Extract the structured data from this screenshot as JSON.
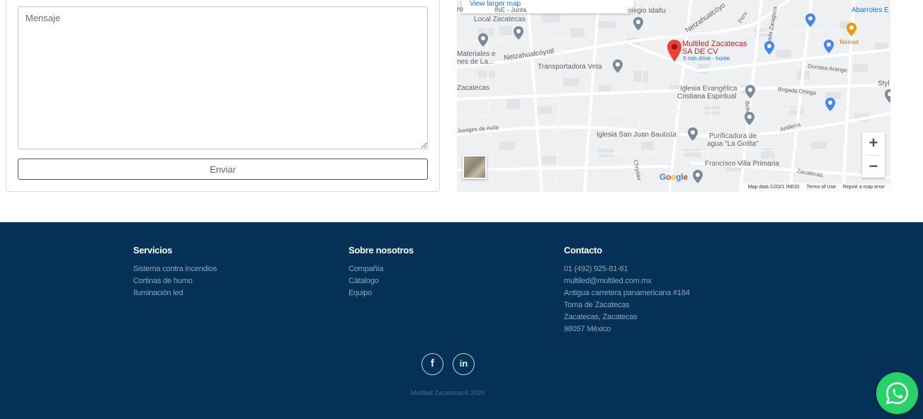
{
  "form": {
    "message_placeholder": "Mensaje",
    "send_label": "Enviar"
  },
  "map": {
    "view_larger": "View larger map",
    "place_name_line1": "Multiled Zacatecas",
    "place_name_line2": "SA DE CV",
    "place_drive": "9 min drive - home",
    "labels": {
      "colegio": "olegio Idaltu",
      "local": "Local Zacatecas",
      "ine": "INE - Junta",
      "materiales1": "Materiales e",
      "materiales2": "nes de La...",
      "netza1": "Netzahualcóyotl",
      "netza2": "Netzahualcóyo",
      "transportadora": "Transportadora Veta",
      "zacatecas": "Zacatecas",
      "iglesia_ev1": "Iglesia Evangélica",
      "iglesia_ev2": "Cristiana Espiritual",
      "brigada": "Brigada Ortega",
      "artiller": "Artillería",
      "iglesia_sj": "Iglesia San Juan Bautista",
      "purificadora1": "Purificadora de",
      "purificadora2": "agua \"La Gotita\"",
      "francisco": "Francisco Villa Primaria",
      "abarrotes": "Abarrotes E",
      "takeout": "Takeout",
      "dorotea": "Dorotea Arango",
      "peru": "Peru",
      "brigada_z": "Brigada Zaragoza",
      "chrysler": "Chrysler",
      "bolivia": "Bolivia",
      "zac_road": "Zacatecas",
      "juwiges": "Juwiges de Avila",
      "styl": "Styl",
      "ro": "ro"
    },
    "zoom_in": "+",
    "zoom_out": "−",
    "google": "Google",
    "attribution": {
      "data": "Map data ©2021 INEGI",
      "terms": "Terms of Use",
      "report": "Report a map error"
    }
  },
  "footer": {
    "servicios": {
      "title": "Servicios",
      "items": [
        "Sistema contra incendios",
        "Cortinas de humo",
        "Iluminación led"
      ]
    },
    "sobre": {
      "title": "Sobre nosotros",
      "items": [
        "Compañía",
        "Cátalogo",
        "Equipo"
      ]
    },
    "contacto": {
      "title": "Contacto",
      "items": [
        "01 (492) 925-81-61",
        "multiled@multiled.com.mx",
        "Antigua carretera panamericana #184",
        "Toma de Zacatecas",
        "Zacatecas, Zacatecas",
        "98057 México"
      ]
    },
    "social": {
      "facebook": "f",
      "linkedin": "in"
    },
    "copyright": "Multiled Zacatecas® 2020"
  },
  "colors": {
    "footer_bg": "#063156",
    "whatsapp": "#25d366",
    "map_pin": "#ea4335"
  }
}
